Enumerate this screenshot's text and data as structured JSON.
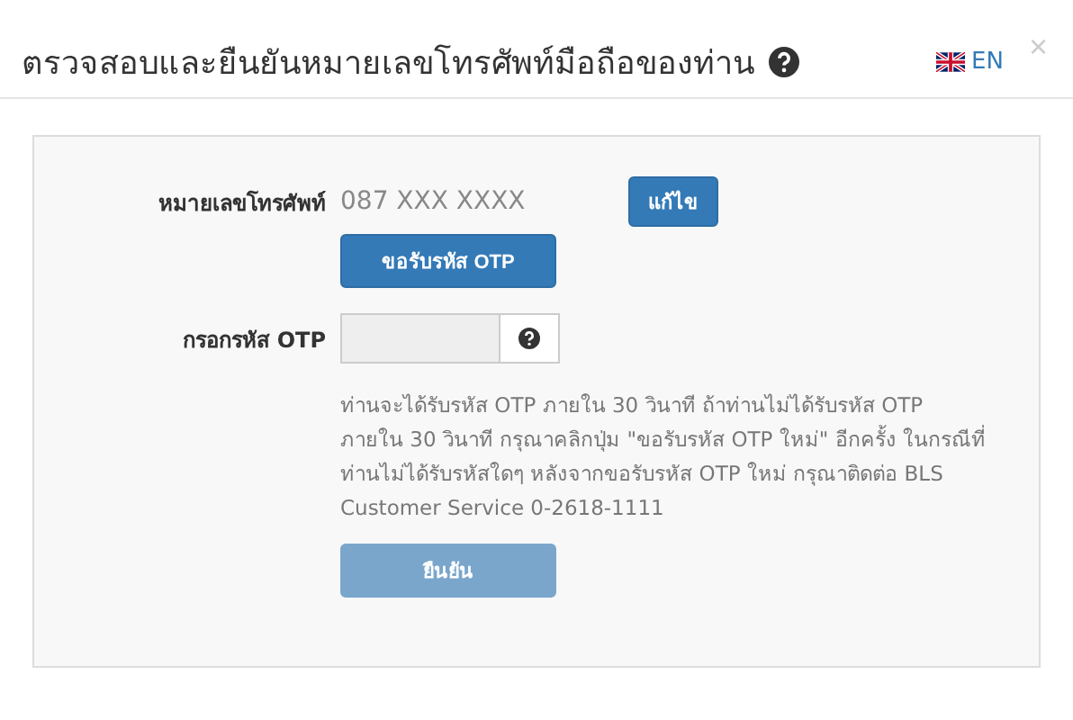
{
  "dialog": {
    "title": "ตรวจสอบและยืนยันหมายเลขโทรศัพท์มือถือของท่าน",
    "language": "EN",
    "close": "×"
  },
  "form": {
    "phone_label": "หมายเลขโทรศัพท์",
    "phone_value": "087 XXX XXXX",
    "edit_button": "แก้ไข",
    "request_button": "ขอรับรหัส OTP",
    "otp_label": "กรอกรหัส OTP",
    "otp_field": {
      "disabled": true
    },
    "note": "ท่านจะได้รับรหัส OTP ภายใน 30 วินาที ถ้าท่านไม่ได้รับรหัส OTP ภายใน 30 วินาที กรุณาคลิกปุ่ม \"ขอรับรหัส OTP ใหม่\" อีกครั้ง ในกรณีที่ท่านไม่ได้รับรหัสใดๆ หลังจากขอรับรหัส OTP ใหม่ กรุณาติดต่อ BLS Customer Service 0-2618-1111",
    "confirm_button": {
      "label": "ยืนยัน",
      "disabled": true
    }
  }
}
